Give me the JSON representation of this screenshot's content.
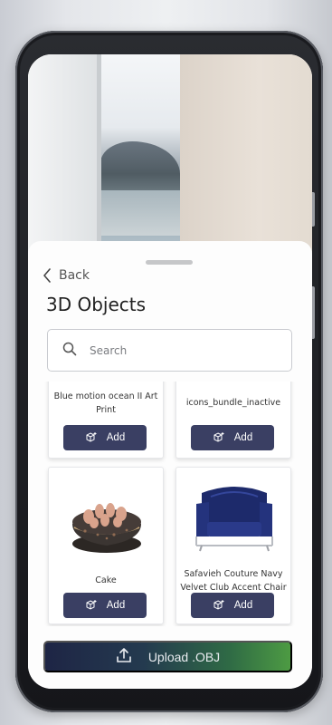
{
  "sheet": {
    "back_label": "Back",
    "title": "3D Objects",
    "search": {
      "placeholder": "Search",
      "value": ""
    }
  },
  "objects": [
    {
      "name": "Blue motion ocean II Art Print",
      "add_label": "Add"
    },
    {
      "name": "icons_bundle_inactive",
      "add_label": "Add"
    },
    {
      "name": "Cake",
      "add_label": "Add"
    },
    {
      "name": "Safavieh Couture Navy Velvet Club Accent Chair",
      "add_label": "Add"
    }
  ],
  "upload": {
    "label": "Upload .OBJ"
  },
  "colors": {
    "add_button": "#3a3f63",
    "upload_gradient_start": "#1e2545",
    "upload_gradient_end": "#4d9b43"
  },
  "icons": [
    "chevron-left-icon",
    "search-icon",
    "cube-plus-icon",
    "upload-icon",
    "cake-image",
    "chair-image"
  ]
}
